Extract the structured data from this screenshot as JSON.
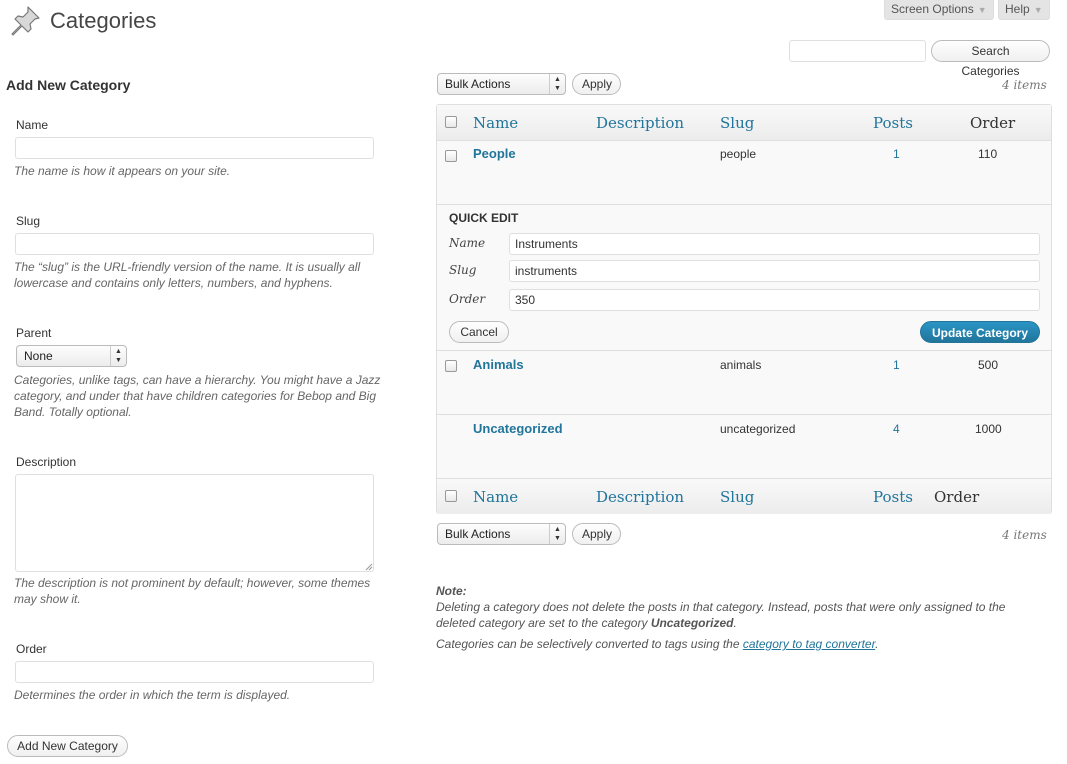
{
  "header": {
    "title": "Categories",
    "screen_options": "Screen Options",
    "help": "Help"
  },
  "search": {
    "value": "",
    "button": "Search Categories"
  },
  "form": {
    "heading": "Add New Category",
    "name_label": "Name",
    "name_hint": "The name is how it appears on your site.",
    "slug_label": "Slug",
    "slug_hint_1": "The “slug” is the URL-friendly version of the name. It is usually all",
    "slug_hint_2": "lowercase and contains only letters, numbers, and hyphens.",
    "parent_label": "Parent",
    "parent_selected": "None",
    "parent_hint_1": "Categories, unlike tags, can have a hierarchy. You might have a Jazz",
    "parent_hint_2": "category, and under that have children categories for Bebop and Big",
    "parent_hint_3": "Band. Totally optional.",
    "description_label": "Description",
    "description_hint_1": "The description is not prominent by default; however, some themes",
    "description_hint_2": "may show it.",
    "order_label": "Order",
    "order_hint": "Determines the order in which the term is displayed.",
    "submit": "Add New Category"
  },
  "bulk": {
    "select": "Bulk Actions",
    "apply": "Apply",
    "count": "4 items"
  },
  "table": {
    "headers": {
      "name": "Name",
      "description": "Description",
      "slug": "Slug",
      "posts": "Posts",
      "order": "Order"
    },
    "rows": [
      {
        "name": "People",
        "slug": "people",
        "posts": "1",
        "order": "110"
      },
      {
        "name": "Animals",
        "slug": "animals",
        "posts": "1",
        "order": "500"
      },
      {
        "name": "Uncategorized",
        "slug": "uncategorized",
        "posts": "4",
        "order": "1000"
      }
    ]
  },
  "quick_edit": {
    "heading": "QUICK EDIT",
    "name_label": "Name",
    "name_value": "Instruments",
    "slug_label": "Slug",
    "slug_value": "instruments",
    "order_label": "Order",
    "order_value": "350",
    "cancel": "Cancel",
    "update": "Update Category"
  },
  "note": {
    "label": "Note:",
    "line1": "Deleting a category does not delete the posts in that category. Instead, posts that were only assigned to the",
    "line2_prefix": "deleted category are set to the category ",
    "line2_bold": "Uncategorized",
    "line2_suffix": ".",
    "line3_prefix": "Categories can be selectively converted to tags using the ",
    "line3_link": "category to tag converter",
    "line3_suffix": "."
  },
  "colors": {
    "link": "#21759b",
    "primary_button": "#21759b"
  }
}
